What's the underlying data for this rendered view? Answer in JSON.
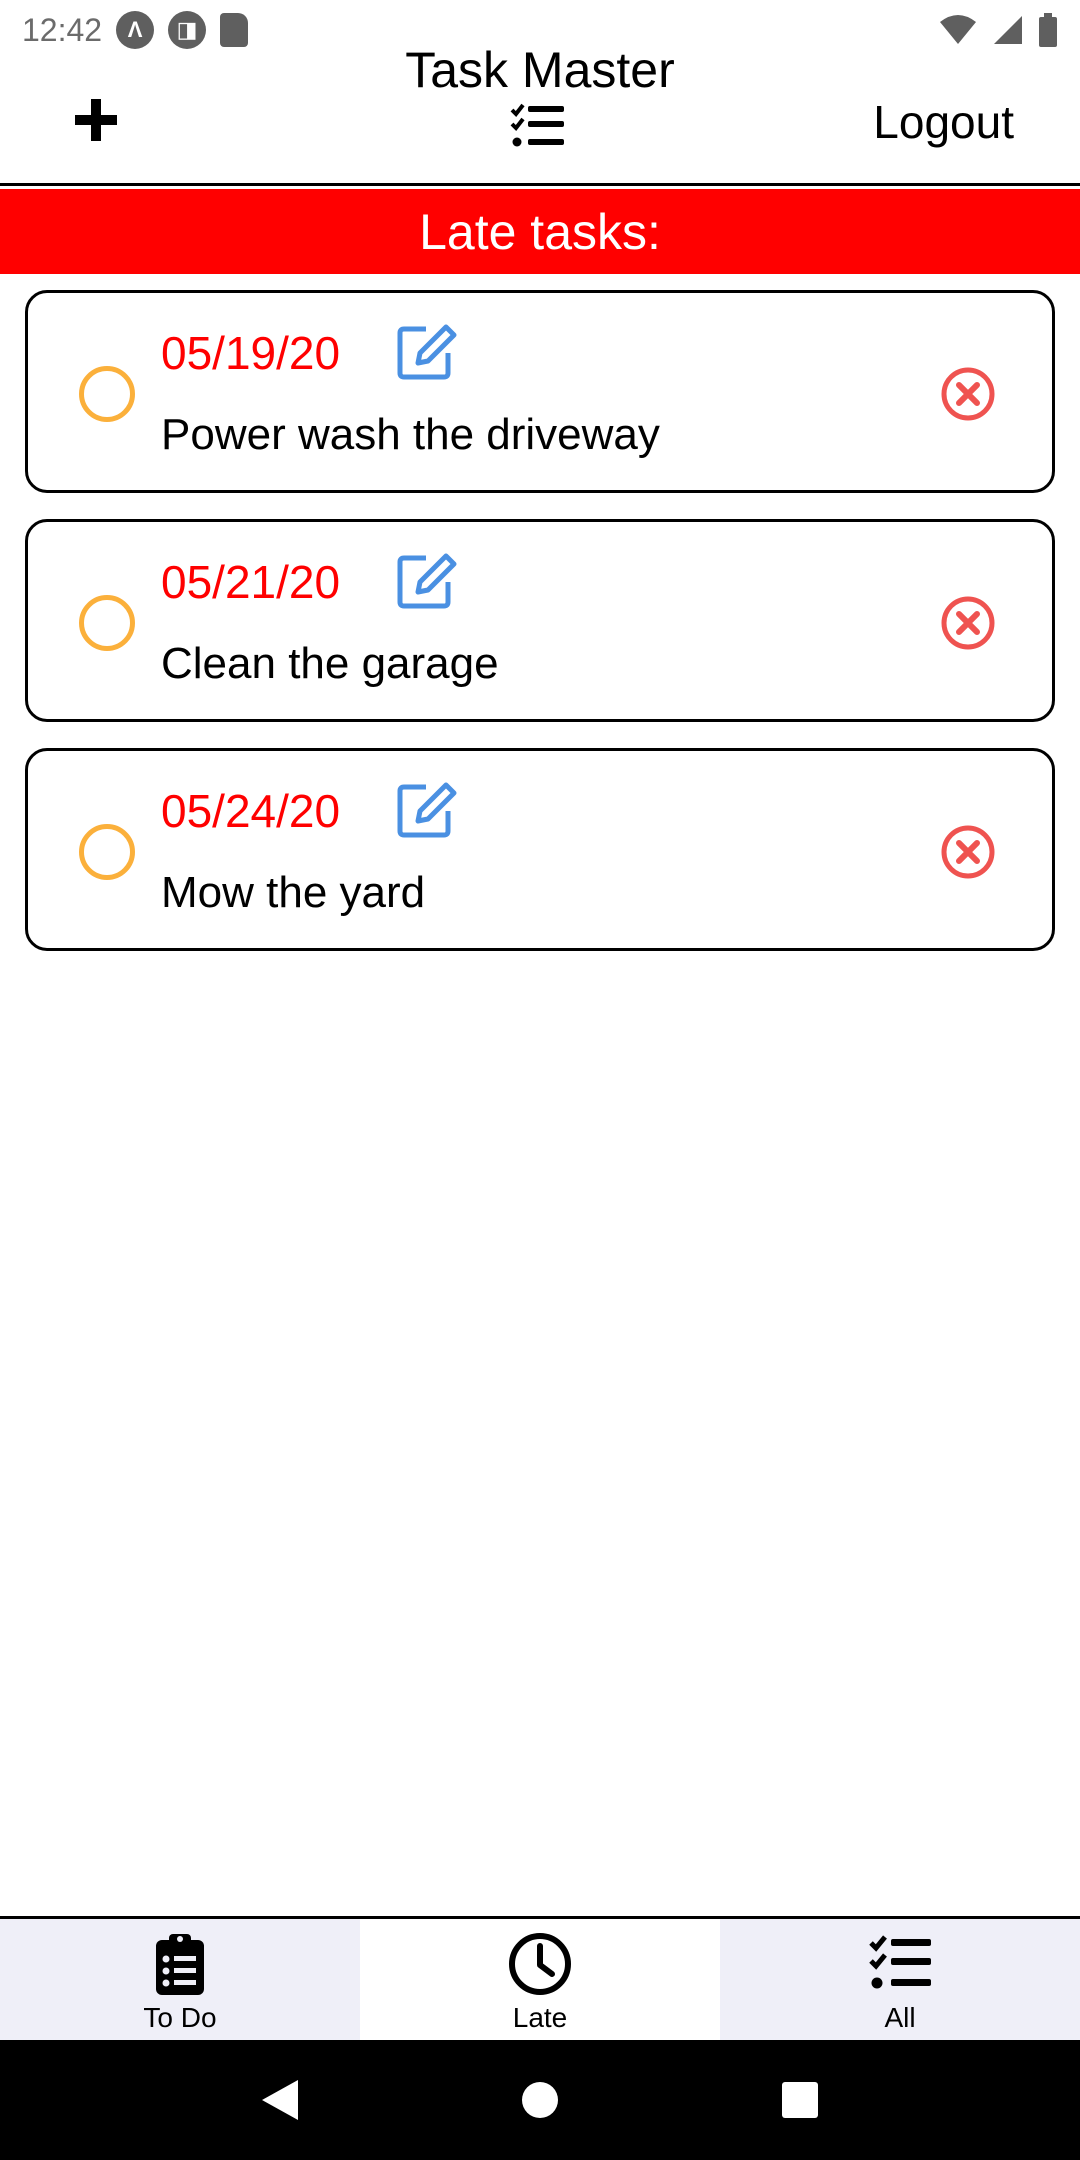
{
  "status_bar": {
    "time": "12:42",
    "icons": [
      "app-a-icon",
      "app-b-icon",
      "sd-card-icon",
      "wifi-icon",
      "signal-icon",
      "battery-icon"
    ]
  },
  "header": {
    "title": "Task Master",
    "logout_label": "Logout",
    "add_icon": "plus-icon",
    "title_icon": "checklist-icon"
  },
  "banner": {
    "label": "Late tasks:"
  },
  "tasks": [
    {
      "date": "05/19/20",
      "title": "Power wash the driveway"
    },
    {
      "date": "05/21/20",
      "title": "Clean the garage"
    },
    {
      "date": "05/24/20",
      "title": "Mow the yard"
    }
  ],
  "tabs": [
    {
      "label": "To Do",
      "icon": "clipboard-list-icon",
      "active": false
    },
    {
      "label": "Late",
      "icon": "clock-icon",
      "active": true
    },
    {
      "label": "All",
      "icon": "checklist-icon",
      "active": false
    }
  ],
  "colors": {
    "banner": "#ff0000",
    "date": "#ff0000",
    "complete_circle": "#fbb03b",
    "edit_icon": "#4a90e2",
    "delete_icon": "#ef5350",
    "tab_inactive_bg": "#efeff8"
  }
}
